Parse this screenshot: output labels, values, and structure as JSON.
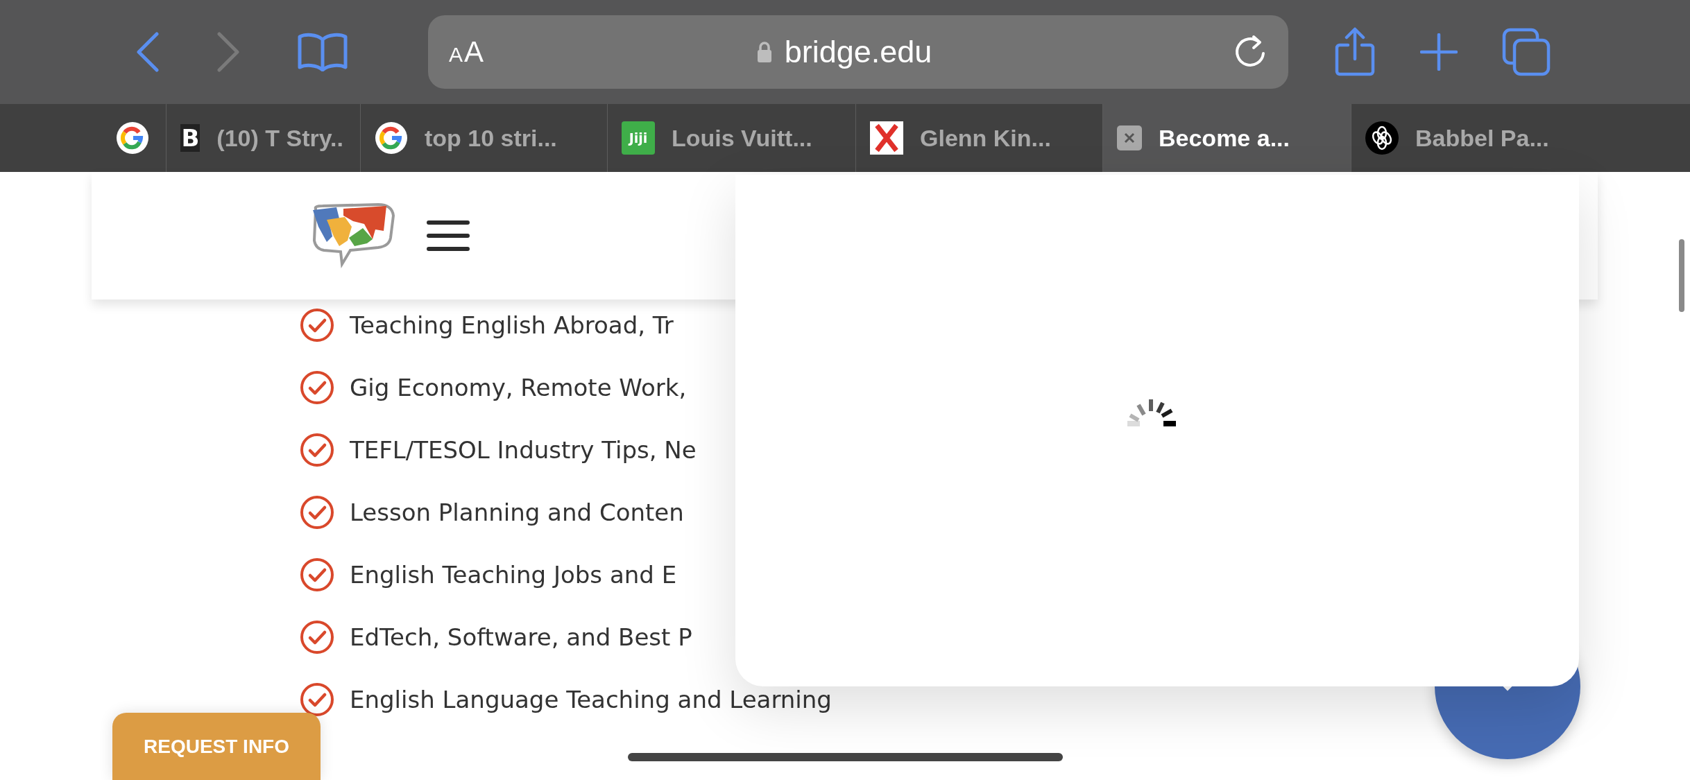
{
  "toolbar": {
    "back_enabled": true,
    "forward_enabled": false,
    "text_size_button": "AA",
    "address": "bridge.edu",
    "secure": true
  },
  "tabs": [
    {
      "kind": "ring",
      "selected": false
    },
    {
      "kind": "letter",
      "favicon_text": "B",
      "title": "(10) T Stry..",
      "selected": false
    },
    {
      "kind": "ring",
      "title": "top 10 stri...",
      "selected": false
    },
    {
      "kind": "tile",
      "favicon_text": "Jiji",
      "title": "Louis Vuitt...",
      "selected": false
    },
    {
      "kind": "cross",
      "title": "Glenn Kin...",
      "selected": false
    },
    {
      "kind": "close",
      "title": "Become a...",
      "selected": true
    },
    {
      "kind": "knot",
      "title": "Babbel Pa...",
      "selected": false
    }
  ],
  "topics": [
    {
      "text": "Teaching English Abroad, Tr",
      "checked": true
    },
    {
      "text": "Gig Economy, Remote Work,",
      "checked": true
    },
    {
      "text": "TEFL/TESOL Industry Tips, Ne",
      "checked": true
    },
    {
      "text": "Lesson Planning and Conten",
      "checked": true
    },
    {
      "text": "English Teaching Jobs and E",
      "checked": true
    },
    {
      "text": "EdTech, Software, and Best P",
      "checked": true
    },
    {
      "text": "English Language Teaching and Learning",
      "checked": true
    }
  ],
  "popup": {
    "loading": true
  },
  "request_button": "REQUEST INFO"
}
